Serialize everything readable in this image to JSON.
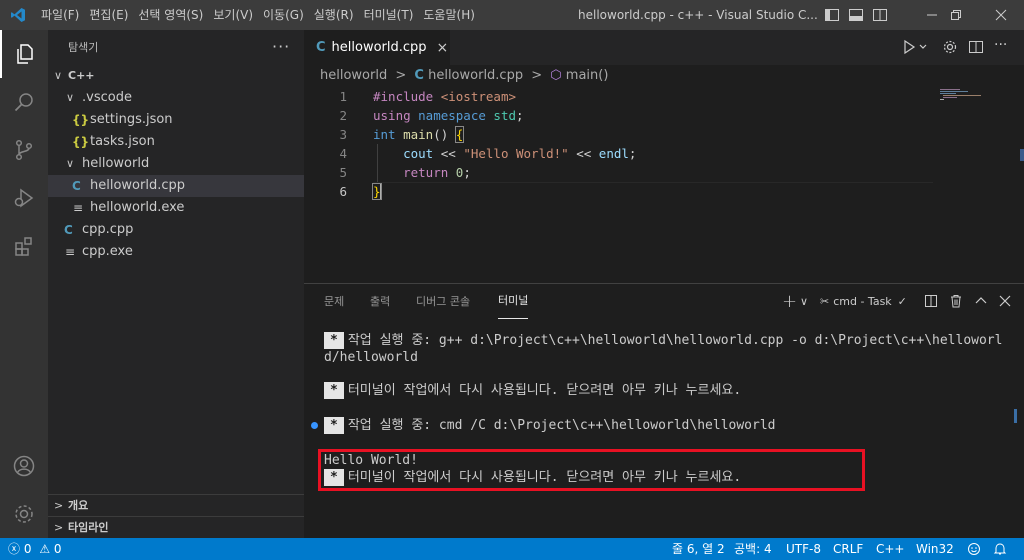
{
  "titlebar": {
    "menus": [
      "파일(F)",
      "편집(E)",
      "선택 영역(S)",
      "보기(V)",
      "이동(G)",
      "실행(R)",
      "터미널(T)",
      "도움말(H)"
    ],
    "window_title": "helloworld.cpp - c++ - Visual Studio C...",
    "accent": "#3c3c3c"
  },
  "activity_bar": {
    "items": [
      "explorer-icon",
      "search-icon",
      "source-control-icon",
      "run-debug-icon",
      "extensions-icon"
    ],
    "bottom": [
      "account-icon",
      "settings-gear-icon"
    ]
  },
  "sidebar": {
    "title": "탐색기",
    "more": "···",
    "root": "C++",
    "tree": [
      {
        "label": ".vscode",
        "kind": "folder"
      },
      {
        "label": "settings.json",
        "kind": "json",
        "icon_text": "{}"
      },
      {
        "label": "tasks.json",
        "kind": "json",
        "icon_text": "{}"
      },
      {
        "label": "helloworld",
        "kind": "folder"
      },
      {
        "label": "helloworld.cpp",
        "kind": "cpp",
        "icon_text": "C",
        "selected": true
      },
      {
        "label": "helloworld.exe",
        "kind": "exe",
        "icon_text": "≡"
      },
      {
        "label": "cpp.cpp",
        "kind": "cpp",
        "icon_text": "C"
      },
      {
        "label": "cpp.exe",
        "kind": "exe",
        "icon_text": "≡"
      }
    ],
    "sections": [
      "개요",
      "타임라인"
    ]
  },
  "editor": {
    "tab_label": "helloworld.cpp",
    "tab_close": "×",
    "breadcrumb": [
      "helloworld",
      "helloworld.cpp",
      "main()"
    ],
    "line_numbers": [
      "1",
      "2",
      "3",
      "4",
      "5",
      "6"
    ],
    "code_tokens": {
      "l1_include": "#include ",
      "l1_header": "<iostream>",
      "l2_using": "using ",
      "l2_namespace": "namespace ",
      "l2_std": "std",
      "l2_semi": ";",
      "l3_int": "int ",
      "l3_main": "main",
      "l3_parens": "() ",
      "l3_brace": "{",
      "l4_indent": "    ",
      "l4_cout": "cout",
      "l4_op1": " << ",
      "l4_str": "\"Hello World!\"",
      "l4_op2": " << ",
      "l4_endl": "endl",
      "l4_semi": ";",
      "l5_indent": "    ",
      "l5_return": "return ",
      "l5_zero": "0",
      "l5_semi": ";",
      "l6_brace": "}"
    }
  },
  "panel": {
    "tabs": [
      "문제",
      "출력",
      "디버그 콘솔",
      "터미널"
    ],
    "active_tab": "터미널",
    "task_label": "cmd - Task",
    "add_symbol": "+",
    "terminal": {
      "star": "*",
      "line1": "작업 실행 중: g++ d:\\Project\\c++\\helloworld\\helloworld.cpp -o d:\\Project\\c++\\helloworld/helloworld",
      "line2": "터미널이 작업에서 다시 사용됩니다. 닫으려면 아무 키나 누르세요.",
      "line3": "작업 실행 중: cmd /C d:\\Project\\c++\\helloworld\\helloworld",
      "output": "Hello World!",
      "line4": "터미널이 작업에서 다시 사용됩니다. 닫으려면 아무 키나 누르세요."
    },
    "highlight_color": "#e81123"
  },
  "statusbar": {
    "errors": "0",
    "warnings": "0",
    "position": "줄 6, 열 2",
    "spaces": "공백: 4",
    "encoding": "UTF-8",
    "eol": "CRLF",
    "language": "C++",
    "platform": "Win32",
    "color": "#007acc"
  }
}
